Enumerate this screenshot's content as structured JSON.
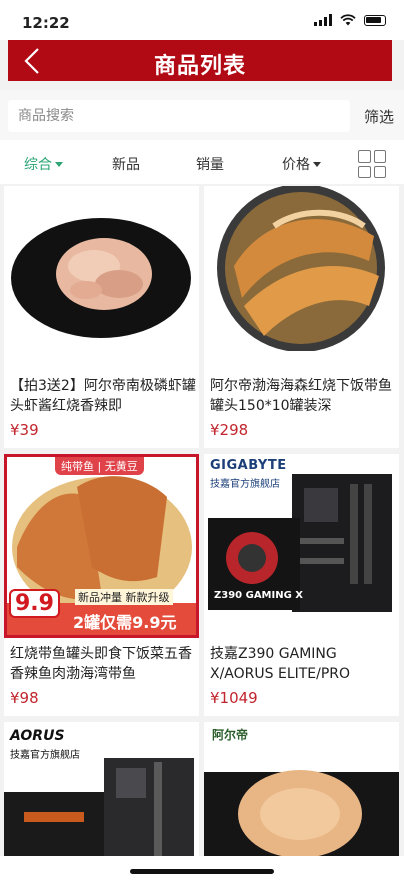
{
  "status": {
    "time": "12:22"
  },
  "nav": {
    "title": "商品列表"
  },
  "search": {
    "placeholder": "商品搜索",
    "filter_label": "筛选"
  },
  "sort": {
    "items": [
      "综合",
      "新品",
      "销量",
      "价格"
    ],
    "active_color": "#2aa573"
  },
  "colors": {
    "brand_red": "#b10a14",
    "price_red": "#c2252d"
  },
  "products": [
    {
      "title": "【拍3送2】阿尔帝南极磷虾罐头虾酱红烧香辣即",
      "price": "¥39"
    },
    {
      "title": "阿尔帝渤海海森红烧下饭带鱼罐头150*10罐装深",
      "price": "¥298"
    },
    {
      "title": "红烧带鱼罐头即食下饭菜五香香辣鱼肉渤海湾带鱼",
      "price": "¥98",
      "badges": {
        "top": "纯带鱼 | 无黄豆",
        "price_tag": "9.9",
        "promo1": "新品冲量 新款升级",
        "promo2": "2罐仅需9.9元"
      }
    },
    {
      "title": "技嘉Z390 GAMING X/AORUS ELITE/PRO",
      "price": "¥1049",
      "badges": {
        "brand": "GIGABYTE",
        "store": "技嘉官方旗舰店",
        "box_text": "Z390 GAMING X"
      }
    },
    {
      "title": "",
      "price": "",
      "badges": {
        "brand": "AORUS",
        "store": "技嘉官方旗舰店"
      }
    },
    {
      "title": "",
      "price": "",
      "badges": {
        "brand": "阿尔帝"
      }
    }
  ]
}
